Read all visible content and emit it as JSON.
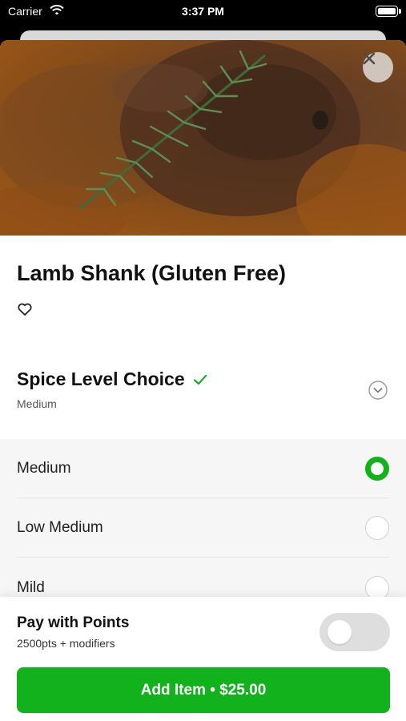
{
  "status_bar": {
    "carrier": "Carrier",
    "time": "3:37 PM",
    "icons": [
      "wifi-icon",
      "battery-icon"
    ]
  },
  "item": {
    "title": "Lamb Shank (Gluten Free)",
    "close_icon": "close-icon",
    "favorite_icon": "heart-outline-icon"
  },
  "modifier_group": {
    "title": "Spice Level Choice",
    "selected_summary": "Medium",
    "check_icon": "checkmark-icon",
    "expand_icon": "chevron-down-circle-icon",
    "options": [
      {
        "label": "Medium",
        "selected": true
      },
      {
        "label": "Low Medium",
        "selected": false
      },
      {
        "label": "Mild",
        "selected": false
      }
    ]
  },
  "points": {
    "title": "Pay with Points",
    "subtitle": "2500pts + modifiers",
    "enabled": false
  },
  "cta": {
    "label": "Add Item • $25.00"
  },
  "colors": {
    "accent": "#12b21c",
    "toggle_off": "#dedede",
    "options_bg": "#f6f6f6"
  }
}
